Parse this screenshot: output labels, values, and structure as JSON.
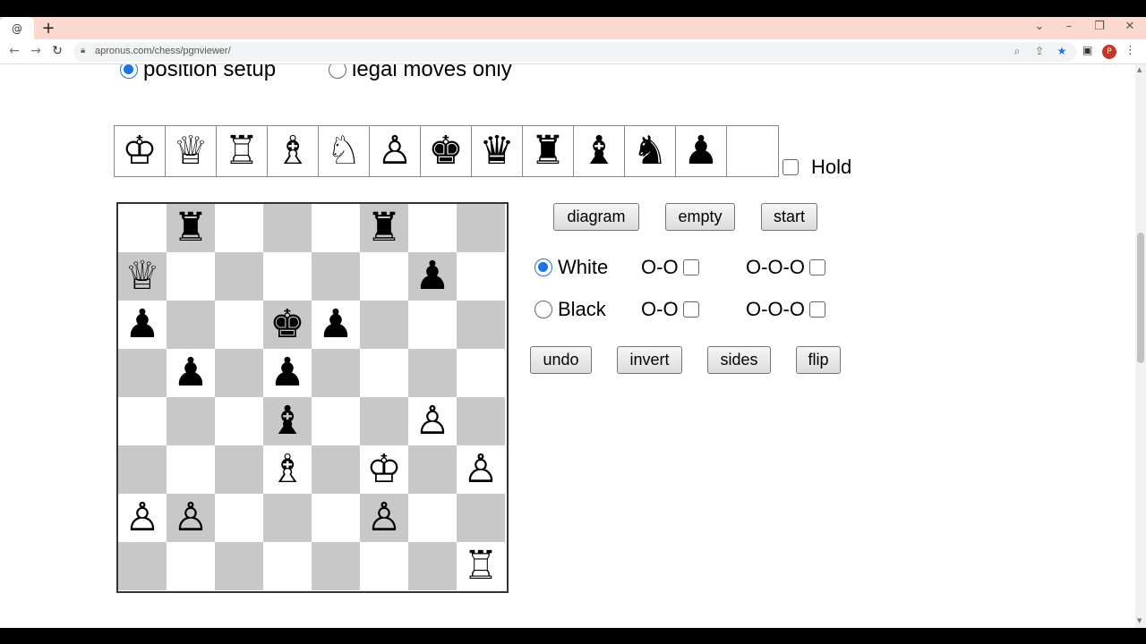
{
  "browser": {
    "tab_icon": "@",
    "url": "apronus.com/chess/pgnviewer/",
    "avatar_letter": "P"
  },
  "mode": {
    "position_setup_label": "position setup",
    "legal_moves_label": "legal moves only",
    "selected": "position setup"
  },
  "palette": {
    "pieces": [
      "♔",
      "♕",
      "♖",
      "♗",
      "♘",
      "♙",
      "♚",
      "♛",
      "♜",
      "♝",
      "♞",
      "♟",
      ""
    ],
    "hold_label": "Hold"
  },
  "board": {
    "ranks": [
      [
        "",
        "♜",
        "",
        "",
        "",
        "♜",
        "",
        ""
      ],
      [
        "♕",
        "",
        "",
        "",
        "",
        "",
        "♟",
        ""
      ],
      [
        "♟",
        "",
        "",
        "♚",
        "♟",
        "",
        "",
        ""
      ],
      [
        "",
        "♟",
        "",
        "♟",
        "",
        "",
        "",
        ""
      ],
      [
        "",
        "",
        "",
        "♝",
        "",
        "",
        "♙",
        ""
      ],
      [
        "",
        "",
        "",
        "♗",
        "",
        "♔",
        "",
        "♙"
      ],
      [
        "♙",
        "♙",
        "",
        "",
        "",
        "♙",
        "",
        ""
      ],
      [
        "",
        "",
        "",
        "",
        "",
        "",
        "",
        "♖"
      ]
    ]
  },
  "controls": {
    "diagram": "diagram",
    "empty": "empty",
    "start": "start",
    "white": "White",
    "black": "Black",
    "short_castle": "O-O",
    "long_castle": "O-O-O",
    "undo": "undo",
    "invert": "invert",
    "sides": "sides",
    "flip": "flip",
    "side_to_move": "White"
  },
  "colors": {
    "dark_square": "#c8c8c8",
    "light_square": "#ffffff",
    "accent": "#1a73e8",
    "tabstrip": "#fbd9cf"
  }
}
